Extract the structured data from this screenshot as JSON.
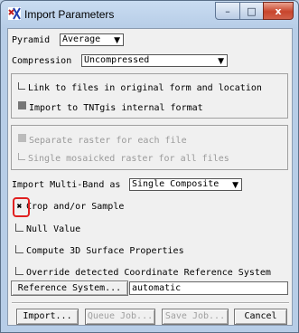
{
  "window": {
    "title": "Import Parameters",
    "controls": {
      "minimize": "–",
      "maximize": "□",
      "close": "x"
    }
  },
  "pyramid": {
    "label": "Pyramid",
    "value": "Average"
  },
  "compression": {
    "label": "Compression",
    "value": "Uncompressed"
  },
  "link_group": {
    "option_link": "Link to files in original form and location",
    "option_import": "Import to TNTgis internal format",
    "selected": "Import to TNTgis internal format"
  },
  "raster_group": {
    "option_separate": "Separate raster for each file",
    "option_single": "Single mosaicked raster for all files",
    "selected": "Separate raster for each file"
  },
  "multiband": {
    "label": "Import Multi-Band as",
    "value": "Single Composite"
  },
  "checkboxes": {
    "crop": {
      "label": "Crop and/or Sample",
      "checked": true
    },
    "null": {
      "label": "Null Value",
      "checked": false
    },
    "surface": {
      "label": "Compute 3D Surface Properties",
      "checked": false
    },
    "override": {
      "label": "Override detected Coordinate Reference System",
      "checked": false
    }
  },
  "reference_system": {
    "button_label": "Reference System...",
    "value": "automatic"
  },
  "buttons": {
    "import": "Import...",
    "queue": "Queue Job...",
    "save": "Save Job...",
    "cancel": "Cancel"
  },
  "colors": {
    "highlight": "#e02020",
    "title_bar": "#c9dcf1",
    "close_button": "#c8452c"
  }
}
